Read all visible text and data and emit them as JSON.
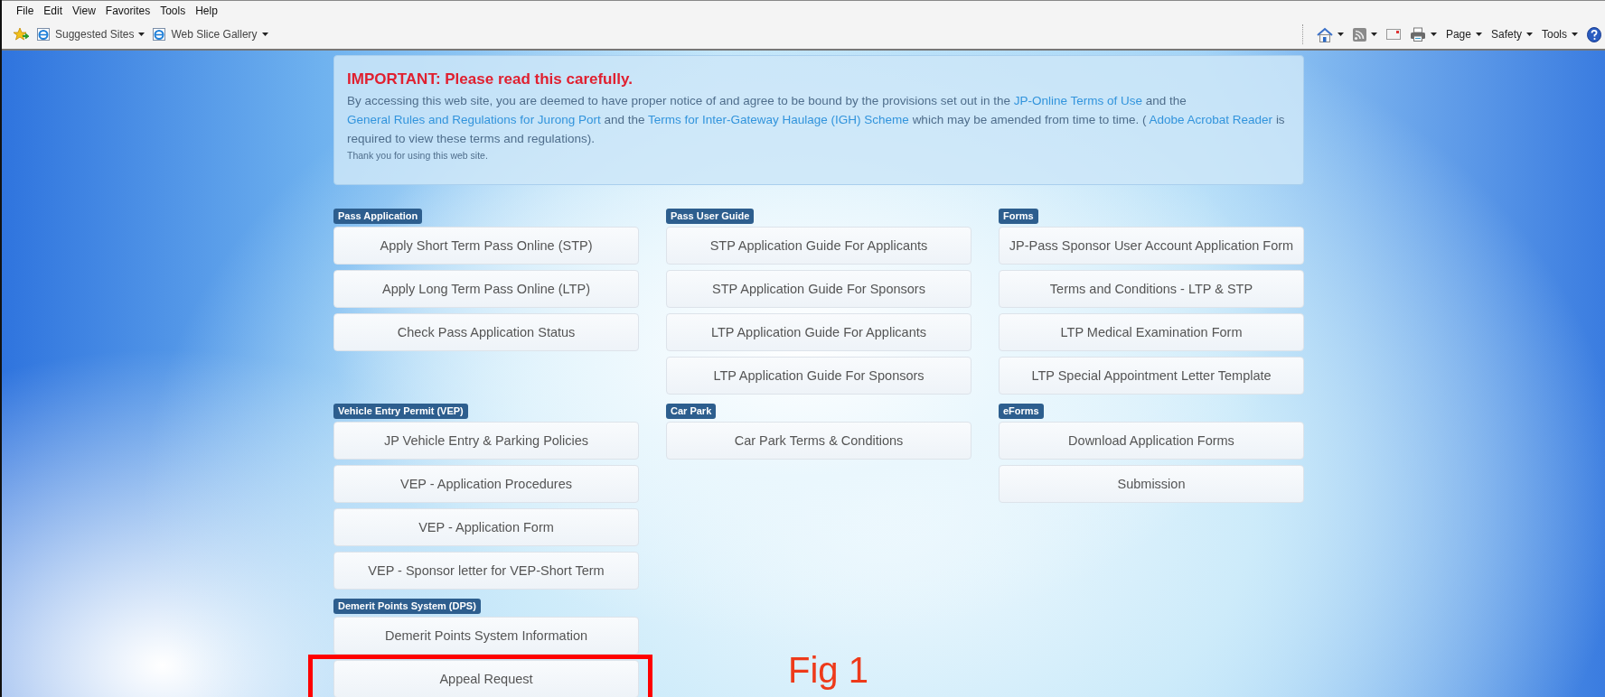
{
  "menu": [
    "File",
    "Edit",
    "View",
    "Favorites",
    "Tools",
    "Help"
  ],
  "favorites_bar": [
    {
      "kind": "favorites",
      "dropdown": false
    },
    {
      "kind": "site",
      "label": "Suggested Sites",
      "dropdown": true
    },
    {
      "kind": "site",
      "label": "Web Slice Gallery",
      "dropdown": true
    }
  ],
  "command_bar": [
    {
      "kind": "home",
      "dropdown": true
    },
    {
      "kind": "feed",
      "dropdown": true
    },
    {
      "kind": "mail",
      "dropdown": false
    },
    {
      "kind": "print",
      "dropdown": true
    },
    {
      "kind": "menu",
      "label": "Page",
      "dropdown": true
    },
    {
      "kind": "menu",
      "label": "Safety",
      "dropdown": true
    },
    {
      "kind": "menu",
      "label": "Tools",
      "dropdown": true
    },
    {
      "kind": "help",
      "dropdown": false
    }
  ],
  "notice": {
    "title": "IMPORTANT: Please read this carefully.",
    "body": [
      {
        "text": "By accessing this web site, you are deemed to have proper notice of and agree to be bound by the provisions set out in the",
        "link": false
      },
      {
        "text": "JP-Online Terms of Use",
        "link": true
      },
      {
        "text": "and the",
        "link": false
      },
      {
        "text": "General Rules and Regulations for Jurong Port",
        "link": true
      },
      {
        "text": "and the",
        "link": false
      },
      {
        "text": "Terms for Inter-Gateway Haulage (IGH) Scheme",
        "link": true
      },
      {
        "text": "which may be amended from time to time. (",
        "link": false
      },
      {
        "text": "Adobe Acrobat Reader",
        "link": true
      },
      {
        "text": "is required to view these terms and regulations).",
        "link": false
      }
    ],
    "thanks": "Thank you for using this web site."
  },
  "section_rows": [
    [
      {
        "label": "Pass Application",
        "buttons": [
          {
            "label": "Apply Short Term Pass Online (STP)",
            "highlighted": false
          },
          {
            "label": "Apply Long Term Pass Online (LTP)",
            "highlighted": false
          },
          {
            "label": "Check Pass Application Status",
            "highlighted": false
          }
        ]
      },
      {
        "label": "Pass User Guide",
        "buttons": [
          {
            "label": "STP Application Guide For Applicants",
            "highlighted": false
          },
          {
            "label": "STP Application Guide For Sponsors",
            "highlighted": false
          },
          {
            "label": "LTP Application Guide For Applicants",
            "highlighted": false
          },
          {
            "label": "LTP Application Guide For Sponsors",
            "highlighted": false
          }
        ]
      },
      {
        "label": "Forms",
        "buttons": [
          {
            "label": "JP-Pass Sponsor User Account Application Form",
            "highlighted": false
          },
          {
            "label": "Terms and Conditions - LTP & STP",
            "highlighted": false
          },
          {
            "label": "LTP Medical Examination Form",
            "highlighted": false
          },
          {
            "label": "LTP Special Appointment Letter Template",
            "highlighted": false
          }
        ]
      }
    ],
    [
      {
        "label": "Vehicle Entry Permit (VEP)",
        "buttons": [
          {
            "label": "JP Vehicle Entry & Parking Policies",
            "highlighted": false
          },
          {
            "label": "VEP - Application Procedures",
            "highlighted": false
          },
          {
            "label": "VEP - Application Form",
            "highlighted": false
          },
          {
            "label": "VEP - Sponsor letter for VEP-Short Term",
            "highlighted": false
          }
        ]
      },
      {
        "label": "Car Park",
        "buttons": [
          {
            "label": "Car Park Terms & Conditions",
            "highlighted": false
          }
        ]
      },
      {
        "label": "eForms",
        "buttons": [
          {
            "label": "Download Application Forms",
            "highlighted": false
          },
          {
            "label": "Submission",
            "highlighted": false
          }
        ]
      }
    ],
    [
      {
        "label": "Demerit Points System (DPS)",
        "buttons": [
          {
            "label": "Demerit Points System Information",
            "highlighted": false
          },
          {
            "label": "Appeal Request",
            "highlighted": true
          }
        ]
      }
    ]
  ],
  "figure_caption": "Fig 1"
}
